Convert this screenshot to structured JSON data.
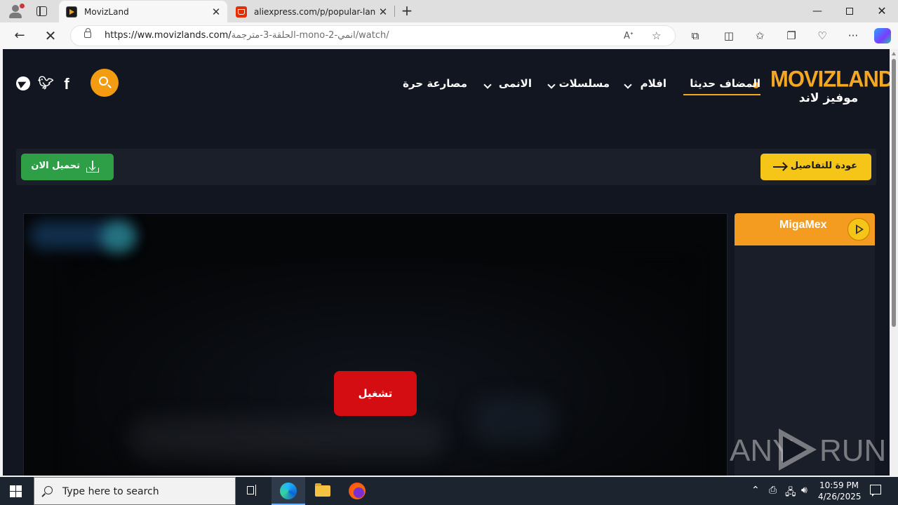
{
  "browser": {
    "tabs": [
      {
        "title": "MovizLand",
        "active": true
      },
      {
        "title": "aliexpress.com/p/popular-landin",
        "active": false
      }
    ],
    "url_host": "https://ww.movizlands.com/",
    "url_path": "الحلقة-3-مترجمة-mono-2-انمي/watch/",
    "window_controls": {
      "minimize": "—",
      "close": "✕"
    }
  },
  "site": {
    "logo": {
      "en": "MOVIZLAND",
      "ar": "موفيز لاند"
    },
    "menu": {
      "recent": "المضاف حديثا",
      "films": "افلام",
      "series": "مسلسلات",
      "anime": "الانمى",
      "wrestling": "مصارعة حرة"
    },
    "actions": {
      "back_to_details": "عودة للتفاصيل",
      "download_now": "تحميل الان"
    },
    "player": {
      "play_label": "تشغيل"
    },
    "server_panel": {
      "server_name": "MigaMex"
    },
    "watermark": {
      "left": "ANY",
      "right": "RUN"
    },
    "colors": {
      "accent": "#f5a623",
      "download": "#2e9e47",
      "play": "#d40d12",
      "back": "#f5c518"
    }
  },
  "taskbar": {
    "search_placeholder": "Type here to search",
    "time": "10:59 PM",
    "date": "4/26/2025"
  }
}
